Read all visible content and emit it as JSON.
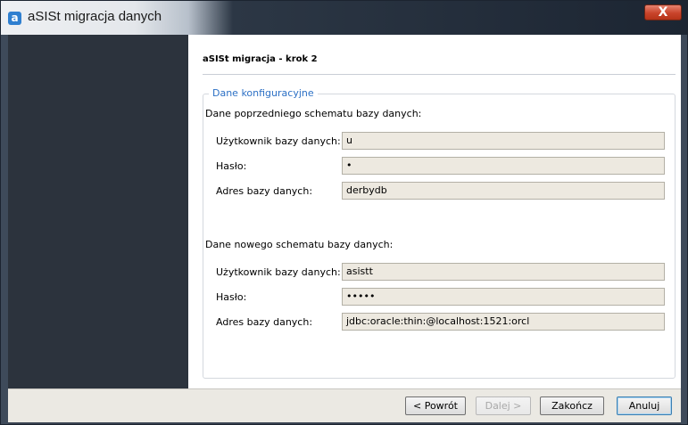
{
  "window": {
    "title": "aSISt migracja danych",
    "app_icon_glyph": "a",
    "close_glyph": "X"
  },
  "wizard": {
    "step_title": "aSISt migracja - krok 2",
    "group_legend": "Dane konfiguracyjne",
    "old_schema": {
      "heading": "Dane poprzedniego schematu bazy danych:",
      "user_label": "Użytkownik bazy danych:",
      "user_value": "u",
      "password_label": "Hasło:",
      "password_value": "•",
      "address_label": "Adres bazy danych:",
      "address_value": "derbydb"
    },
    "new_schema": {
      "heading": "Dane nowego schematu bazy danych:",
      "user_label": "Użytkownik bazy danych:",
      "user_value": "asistt",
      "password_label": "Hasło:",
      "password_value": "•••••",
      "address_label": "Adres bazy danych:",
      "address_value": "jdbc:oracle:thin:@localhost:1521:orcl"
    }
  },
  "footer": {
    "back_label": "< Powrót",
    "next_label": "Dalej >",
    "finish_label": "Zakończ",
    "cancel_label": "Anuluj"
  },
  "colors": {
    "legend": "#2c70c5",
    "field_bg": "#ede9e0",
    "side_panel": "#2c333d",
    "close_button": "#c9442b"
  },
  "icons": {
    "app": "app-logo-icon",
    "close": "close-icon"
  }
}
